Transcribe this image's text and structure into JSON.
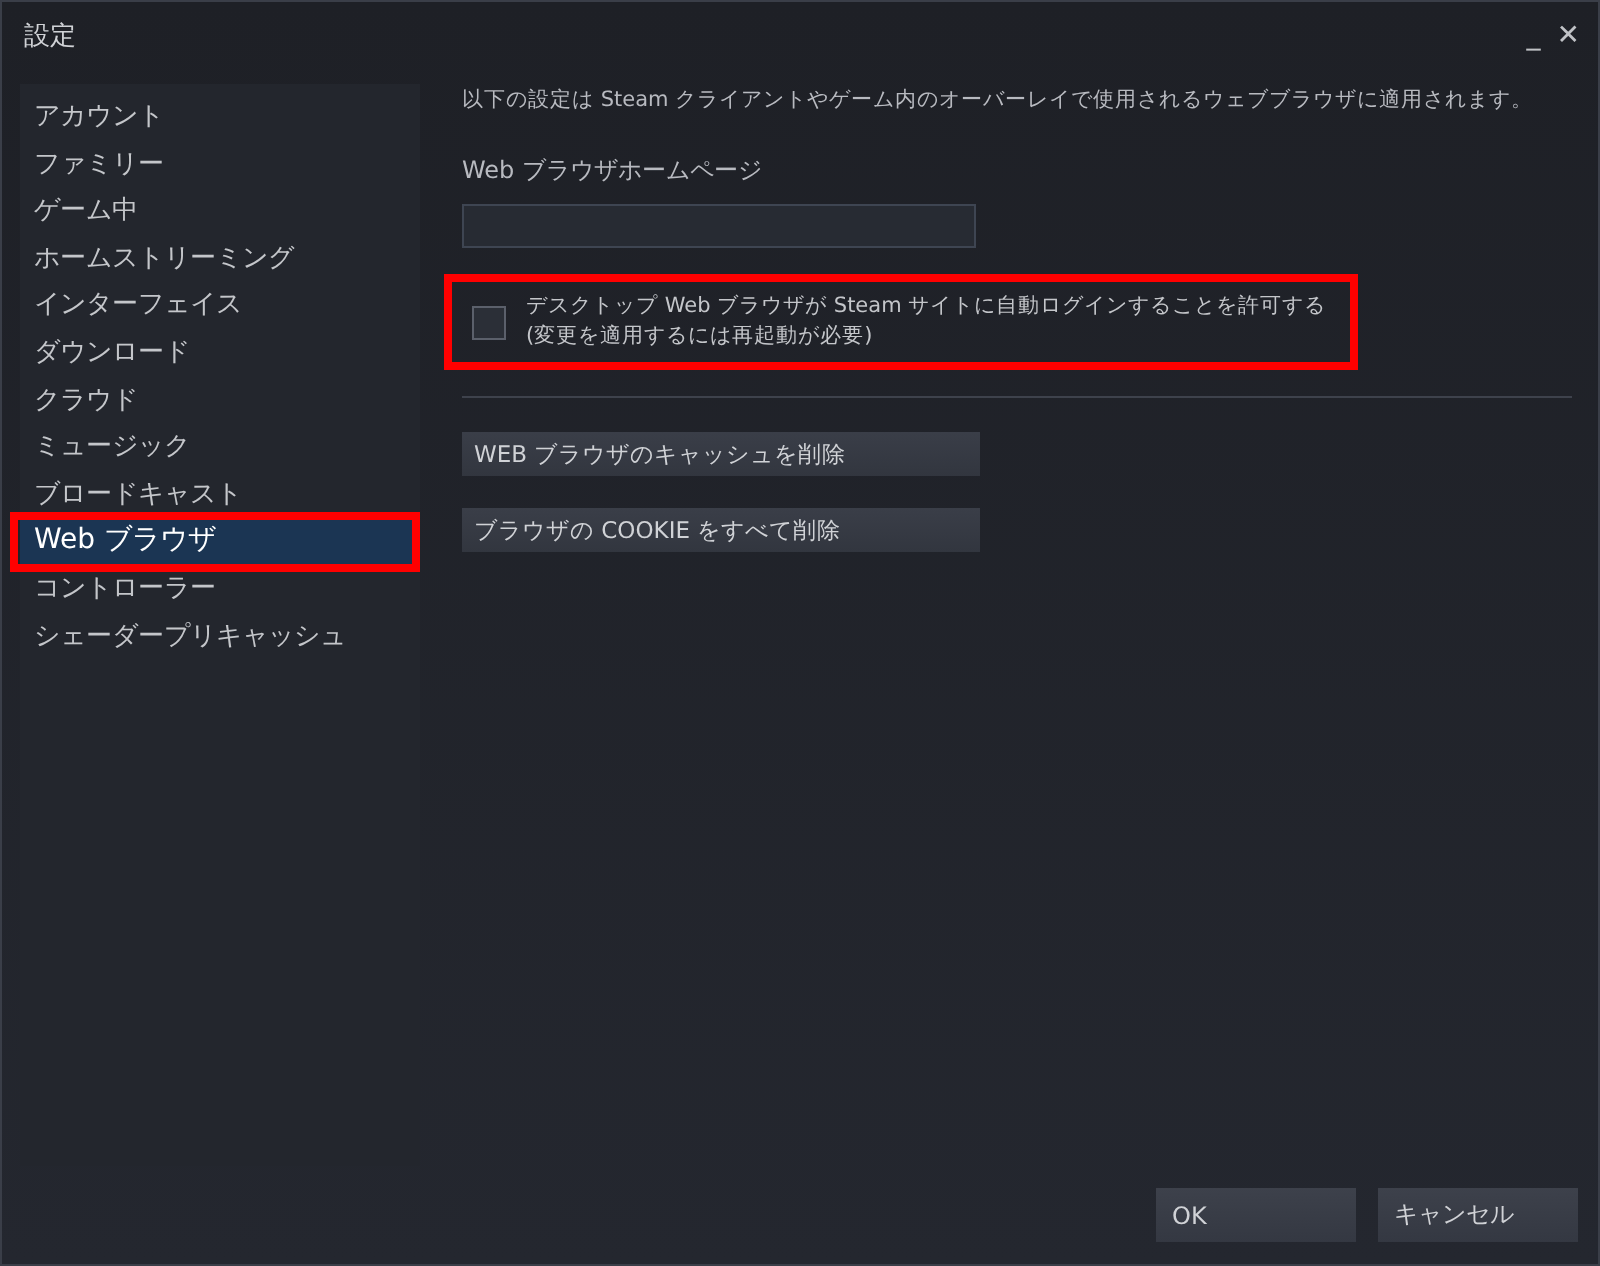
{
  "window": {
    "title": "設定",
    "controls": [
      "_",
      "✕"
    ]
  },
  "sidebar": {
    "items": [
      {
        "label": "アカウント",
        "selected": false,
        "highlighted": false
      },
      {
        "label": "ファミリー",
        "selected": false,
        "highlighted": false
      },
      {
        "label": "ゲーム中",
        "selected": false,
        "highlighted": false
      },
      {
        "label": "ホームストリーミング",
        "selected": false,
        "highlighted": false
      },
      {
        "label": "インターフェイス",
        "selected": false,
        "highlighted": false
      },
      {
        "label": "ダウンロード",
        "selected": false,
        "highlighted": false
      },
      {
        "label": "クラウド",
        "selected": false,
        "highlighted": false
      },
      {
        "label": "ミュージック",
        "selected": false,
        "highlighted": false
      },
      {
        "label": "ブロードキャスト",
        "selected": false,
        "highlighted": false
      },
      {
        "label": "Web ブラウザ",
        "selected": true,
        "highlighted": true
      },
      {
        "label": "コントローラー",
        "selected": false,
        "highlighted": false
      },
      {
        "label": "シェーダープリキャッシュ",
        "selected": false,
        "highlighted": false
      }
    ]
  },
  "content": {
    "description": "以下の設定は Steam クライアントやゲーム内のオーバーレイで使用されるウェブブラウザに適用されます。",
    "homepage_label": "Web ブラウザホームページ",
    "checkbox": {
      "label": "デスクトップ Web ブラウザが Steam サイトに自動ログインすることを許可する",
      "note": "(変更を適用するには再起動が必要)",
      "checked": false,
      "highlighted": true
    },
    "buttons": [
      "WEB ブラウザのキャッシュを削除",
      "ブラウザの COOKIE をすべて削除"
    ]
  },
  "footer": {
    "buttons": [
      "OK",
      "キャンセル"
    ]
  }
}
